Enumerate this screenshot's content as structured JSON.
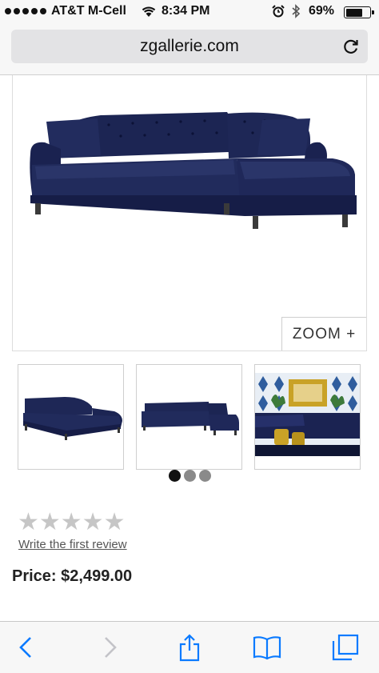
{
  "status_bar": {
    "carrier": "AT&T M-Cell",
    "time": "8:34 PM",
    "battery": "69%",
    "battery_level": 0.69
  },
  "browser": {
    "url": "zgallerie.com"
  },
  "product": {
    "zoom_label": "ZOOM +",
    "write_review": "Write the first review",
    "price": "Price: $2,499.00",
    "rating": 0,
    "star_glyphs": "★★★★★",
    "thumbnail_page": 1,
    "thumbnail_pages": 3
  },
  "colors": {
    "velvet_navy": "#1b2352",
    "ios_blue": "#0a7aff"
  },
  "icons": {
    "reload": "reload-icon",
    "back": "back-icon",
    "forward": "forward-icon",
    "share": "share-icon",
    "bookmarks": "bookmarks-icon",
    "tabs": "tabs-icon"
  }
}
